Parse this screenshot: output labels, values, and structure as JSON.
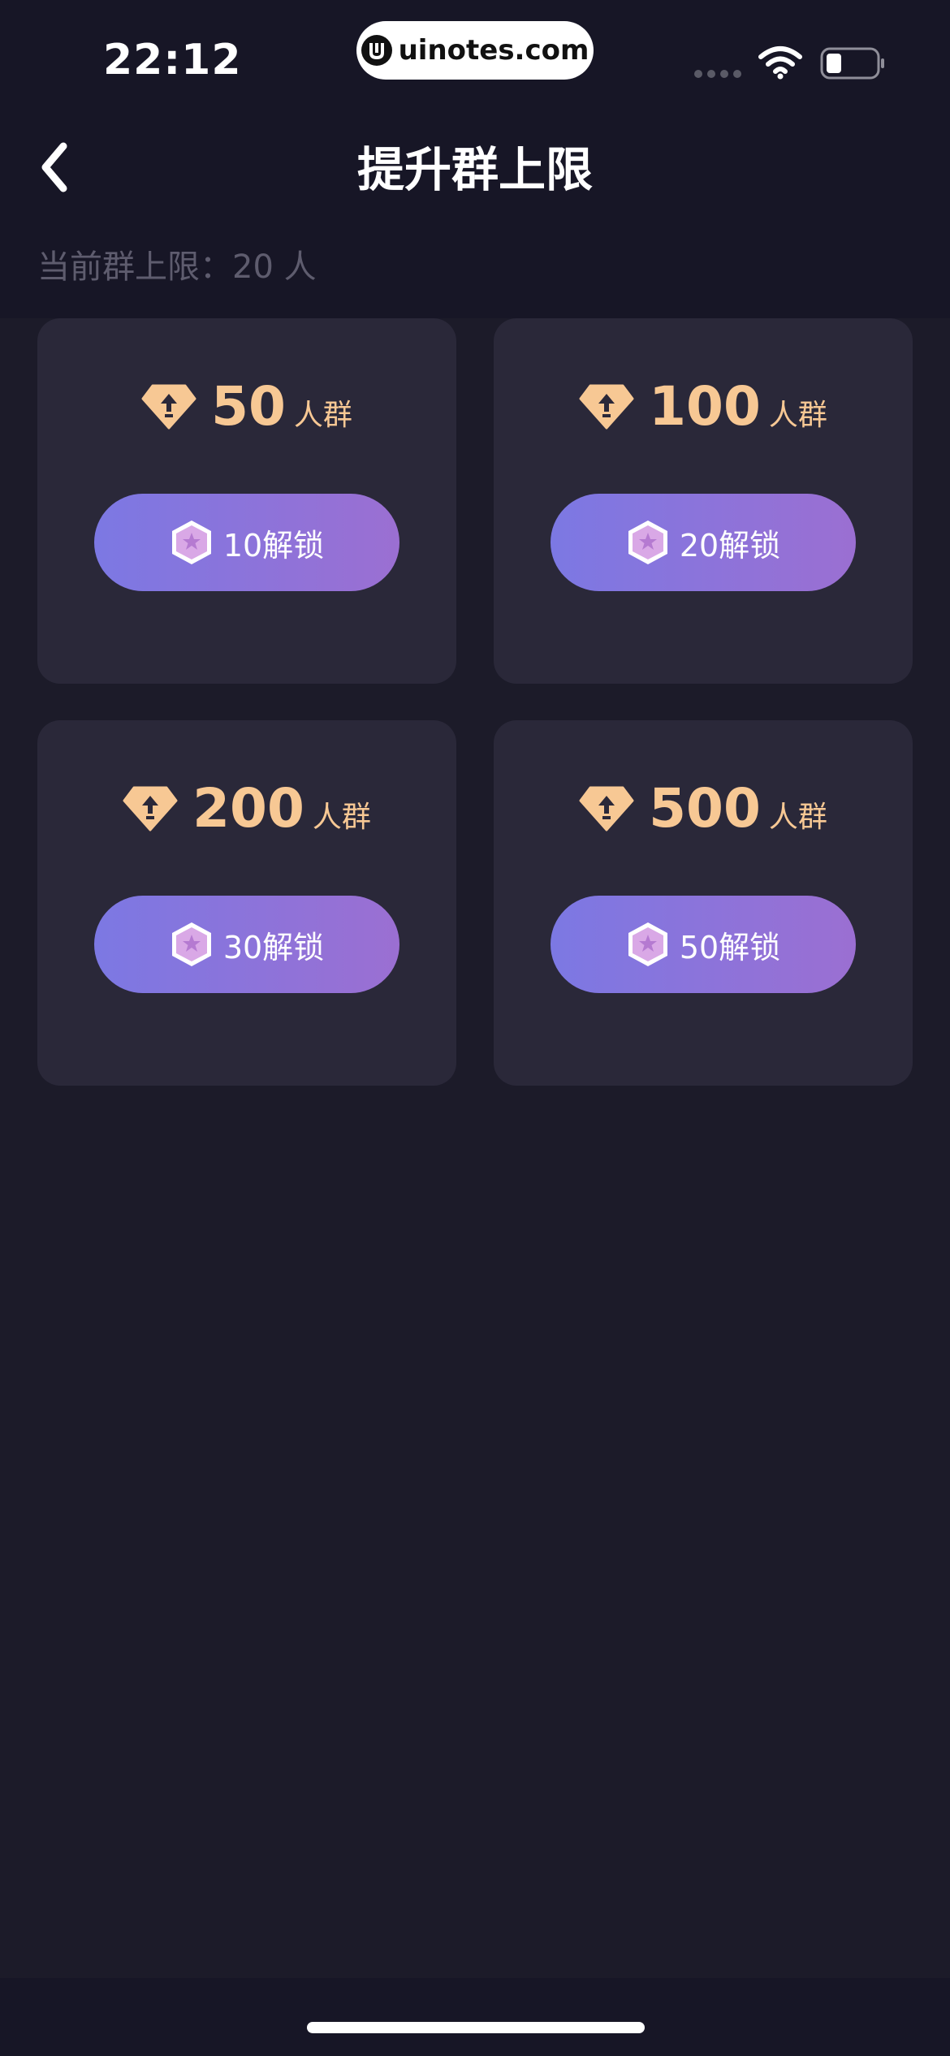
{
  "status_bar": {
    "time": "22:12",
    "url": "uinotes.com"
  },
  "header": {
    "title": "提升群上限",
    "back_icon": "chevron-left-icon"
  },
  "current_limit": {
    "label": "当前群上限：",
    "value": "20 人"
  },
  "colors": {
    "background": "#1c1b29",
    "card": "#2a2839",
    "accent_gold": "#f7c894",
    "button_gradient_start": "#7c78e3",
    "button_gradient_end": "#9b6fd2"
  },
  "tiers": [
    {
      "size": "50",
      "unit": "人群",
      "button_label": "10解锁",
      "icon": "diamond-upgrade-icon",
      "button_icon": "purple-coin-icon"
    },
    {
      "size": "100",
      "unit": "人群",
      "button_label": "20解锁",
      "icon": "diamond-upgrade-icon",
      "button_icon": "purple-coin-icon"
    },
    {
      "size": "200",
      "unit": "人群",
      "button_label": "30解锁",
      "icon": "diamond-upgrade-icon",
      "button_icon": "purple-coin-icon"
    },
    {
      "size": "500",
      "unit": "人群",
      "button_label": "50解锁",
      "icon": "diamond-upgrade-icon",
      "button_icon": "purple-coin-icon"
    }
  ]
}
